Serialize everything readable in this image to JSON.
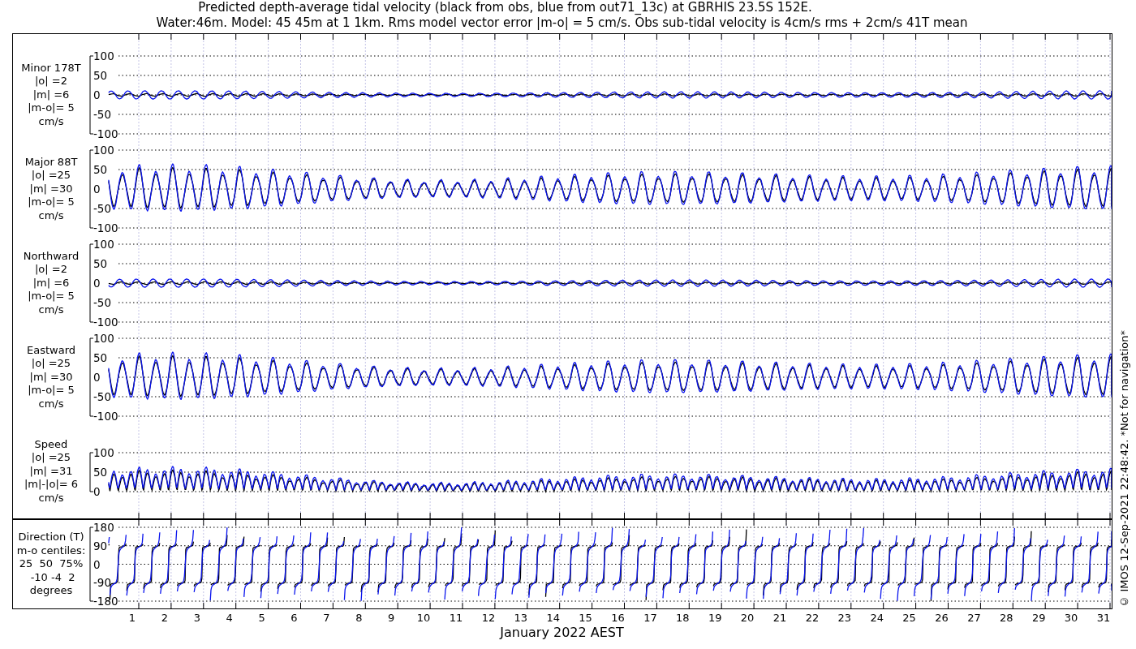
{
  "title": [
    "Predicted depth-average tidal velocity (black from obs, blue from out71_13c) at GBRHIS 23.5S 152E.",
    "Water:46m. Model: 45 45m at 1 1km. Rms model vector error |m-o| = 5 cm/s. Obs sub-tidal velocity is 4cm/s rms + 2cm/s 41T mean"
  ],
  "panels": [
    {
      "kind": "minor",
      "label": [
        "Minor 178T",
        "|o| =2",
        "|m| =6",
        "|m-o|= 5",
        "cm/s"
      ],
      "yticks": [
        "100",
        "50",
        "0",
        "-50",
        "-100"
      ]
    },
    {
      "kind": "major",
      "label": [
        "Major 88T",
        "|o| =25",
        "|m| =30",
        "|m-o|= 5",
        "cm/s"
      ],
      "yticks": [
        "100",
        "50",
        "0",
        "-50",
        "-100"
      ]
    },
    {
      "kind": "northward",
      "label": [
        "Northward",
        "|o| =2",
        "|m| =6",
        "|m-o|= 5",
        "cm/s"
      ],
      "yticks": [
        "100",
        "50",
        "0",
        "-50",
        "-100"
      ]
    },
    {
      "kind": "eastward",
      "label": [
        "Eastward",
        "|o| =25",
        "|m| =30",
        "|m-o|= 5",
        "cm/s"
      ],
      "yticks": [
        "100",
        "50",
        "0",
        "-50",
        "-100"
      ]
    },
    {
      "kind": "speed",
      "label": [
        "Speed",
        "|o| =25",
        "|m| =31",
        "|m|-|o|= 6",
        "cm/s"
      ],
      "yticks": [
        "100",
        "50",
        "0"
      ]
    }
  ],
  "direction_panel": {
    "kind": "direction",
    "label": [
      "Direction (T)",
      "m-o centiles:",
      "25  50  75%",
      " -10 -4  2",
      "degrees"
    ],
    "yticks": [
      "180",
      "90",
      "0",
      "-90",
      "-180"
    ]
  },
  "xticks": [
    "1",
    "2",
    "3",
    "4",
    "5",
    "6",
    "7",
    "8",
    "9",
    "10",
    "11",
    "12",
    "13",
    "14",
    "15",
    "16",
    "17",
    "18",
    "19",
    "20",
    "21",
    "22",
    "23",
    "24",
    "25",
    "26",
    "27",
    "28",
    "29",
    "30",
    "31"
  ],
  "xlabel": "January 2022 AEST",
  "credit": "© IMOS 12-Sep-2021 22:48:42. *Not for navigation*"
}
